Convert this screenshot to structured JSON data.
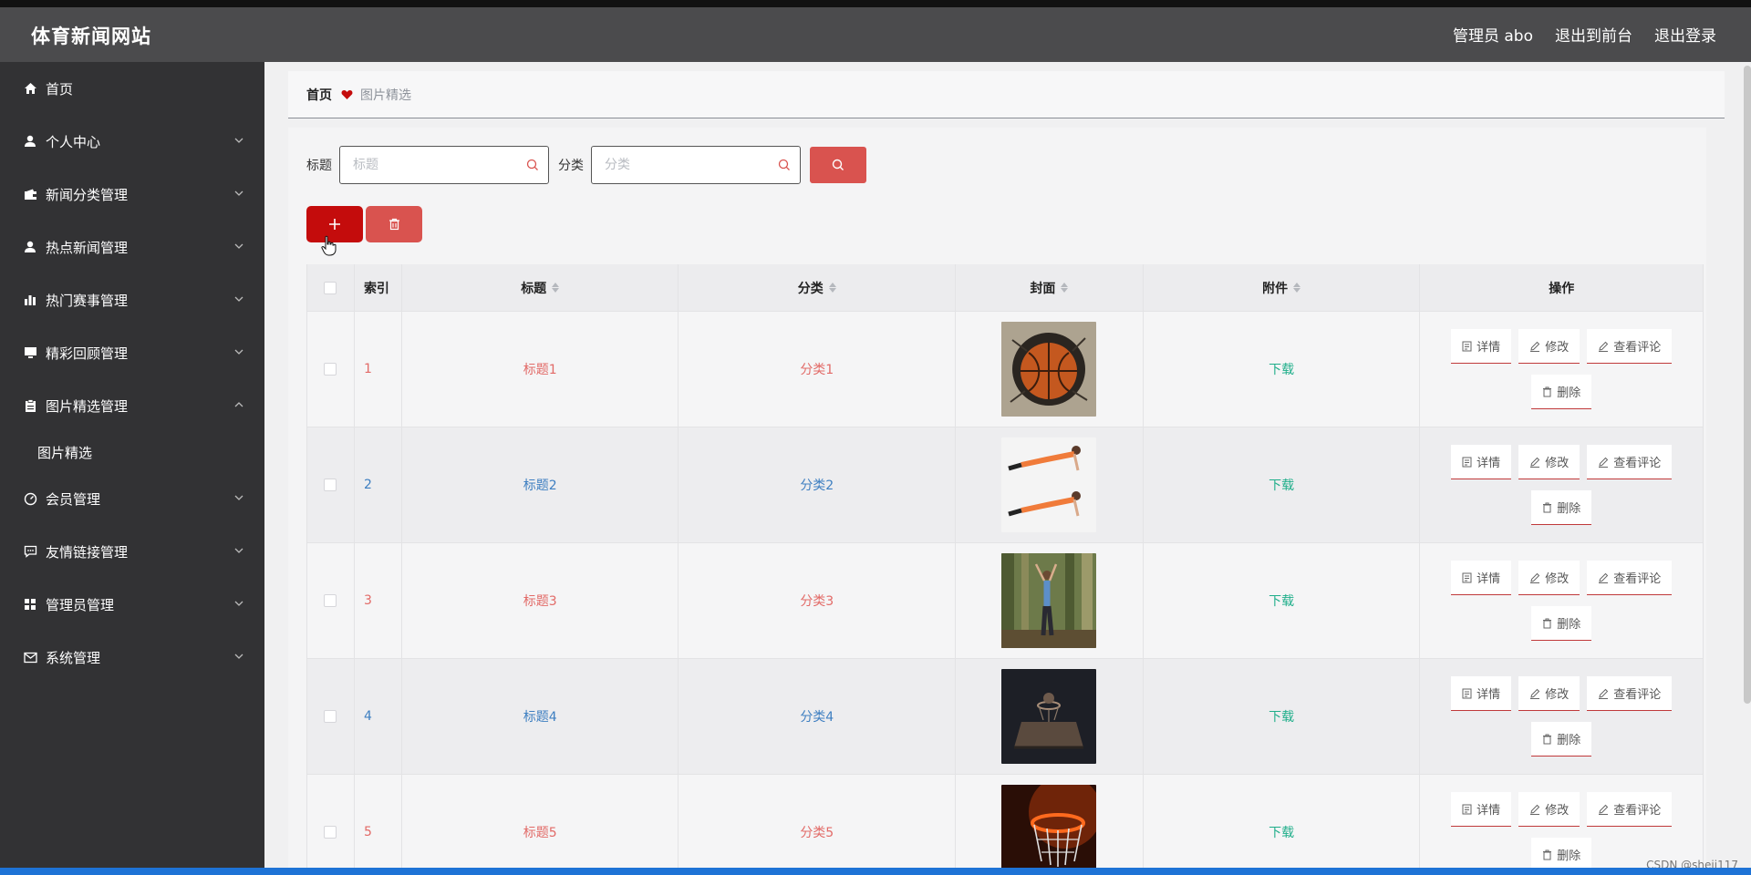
{
  "header": {
    "brand": "体育新闻网站",
    "admin": "管理员 abo",
    "to_front": "退出到前台",
    "logout": "退出登录"
  },
  "sidebar": {
    "items": [
      {
        "label": "首页",
        "icon": "home-icon"
      },
      {
        "label": "个人中心",
        "icon": "user-icon"
      },
      {
        "label": "新闻分类管理",
        "icon": "wallet-icon"
      },
      {
        "label": "热点新闻管理",
        "icon": "user-icon"
      },
      {
        "label": "热门赛事管理",
        "icon": "bar-chart-icon"
      },
      {
        "label": "精彩回顾管理",
        "icon": "monitor-icon"
      },
      {
        "label": "图片精选管理",
        "icon": "clipboard-icon"
      },
      {
        "label": "会员管理",
        "icon": "gauge-icon"
      },
      {
        "label": "友情链接管理",
        "icon": "chat-icon"
      },
      {
        "label": "管理员管理",
        "icon": "grid-icon"
      },
      {
        "label": "系统管理",
        "icon": "mail-icon"
      }
    ],
    "submenu": "图片精选"
  },
  "breadcrumb": {
    "home": "首页",
    "current": "图片精选"
  },
  "search": {
    "title_label": "标题",
    "title_placeholder": "标题",
    "category_label": "分类",
    "category_placeholder": "分类"
  },
  "table": {
    "headers": {
      "index": "索引",
      "title": "标题",
      "category": "分类",
      "cover": "封面",
      "attachment": "附件",
      "actions": "操作"
    },
    "rows": [
      {
        "index": "1",
        "title": "标题1",
        "category": "分类1",
        "file": "下载",
        "cover": "basketball-wall"
      },
      {
        "index": "2",
        "title": "标题2",
        "category": "分类2",
        "file": "下载",
        "cover": "plank-workout"
      },
      {
        "index": "3",
        "title": "标题3",
        "category": "分类3",
        "file": "下载",
        "cover": "forest-stretch"
      },
      {
        "index": "4",
        "title": "标题4",
        "category": "分类4",
        "file": "下载",
        "cover": "dark-hoop"
      },
      {
        "index": "5",
        "title": "标题5",
        "category": "分类5",
        "file": "下载",
        "cover": "fire-hoop"
      }
    ],
    "actions": {
      "detail": "详情",
      "edit": "修改",
      "comments": "查看评论",
      "delete": "删除"
    }
  },
  "watermark": "CSDN @sheji117",
  "colors": {
    "accent_red": "#c40c0c",
    "soft_red": "#d9534f",
    "topbar": "#4b4b4d",
    "sidebar": "#323234",
    "link_green": "#1fae8a",
    "link_blue": "#3e7fc1",
    "link_red": "#e26a67"
  }
}
